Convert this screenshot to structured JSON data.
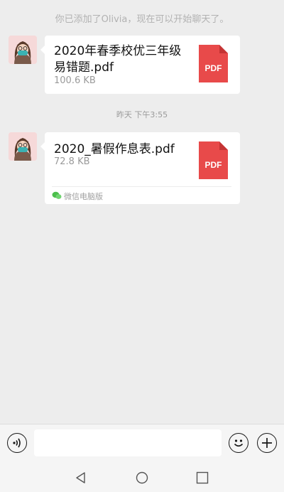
{
  "system_message": "你已添加了Olivia，现在可以开始聊天了。",
  "timestamp": "昨天 下午3:55",
  "messages": [
    {
      "file_name": "2020年春季校优三年级易错题.pdf",
      "file_size": "100.6 KB",
      "file_badge": "PDF"
    },
    {
      "file_name": "2020_暑假作息表.pdf",
      "file_size": "72.8 KB",
      "file_badge": "PDF",
      "source": "微信电脑版"
    }
  ],
  "colors": {
    "pdf_red": "#e84a4a",
    "pdf_fold": "#c53434",
    "background": "#ededed",
    "avatar_bg": "#f6d9d9"
  },
  "icons": {
    "voice": "voice-icon",
    "emoji": "emoji-icon",
    "add": "plus-icon",
    "nav_back": "nav-back-icon",
    "nav_home": "nav-home-icon",
    "nav_recent": "nav-recent-icon"
  }
}
